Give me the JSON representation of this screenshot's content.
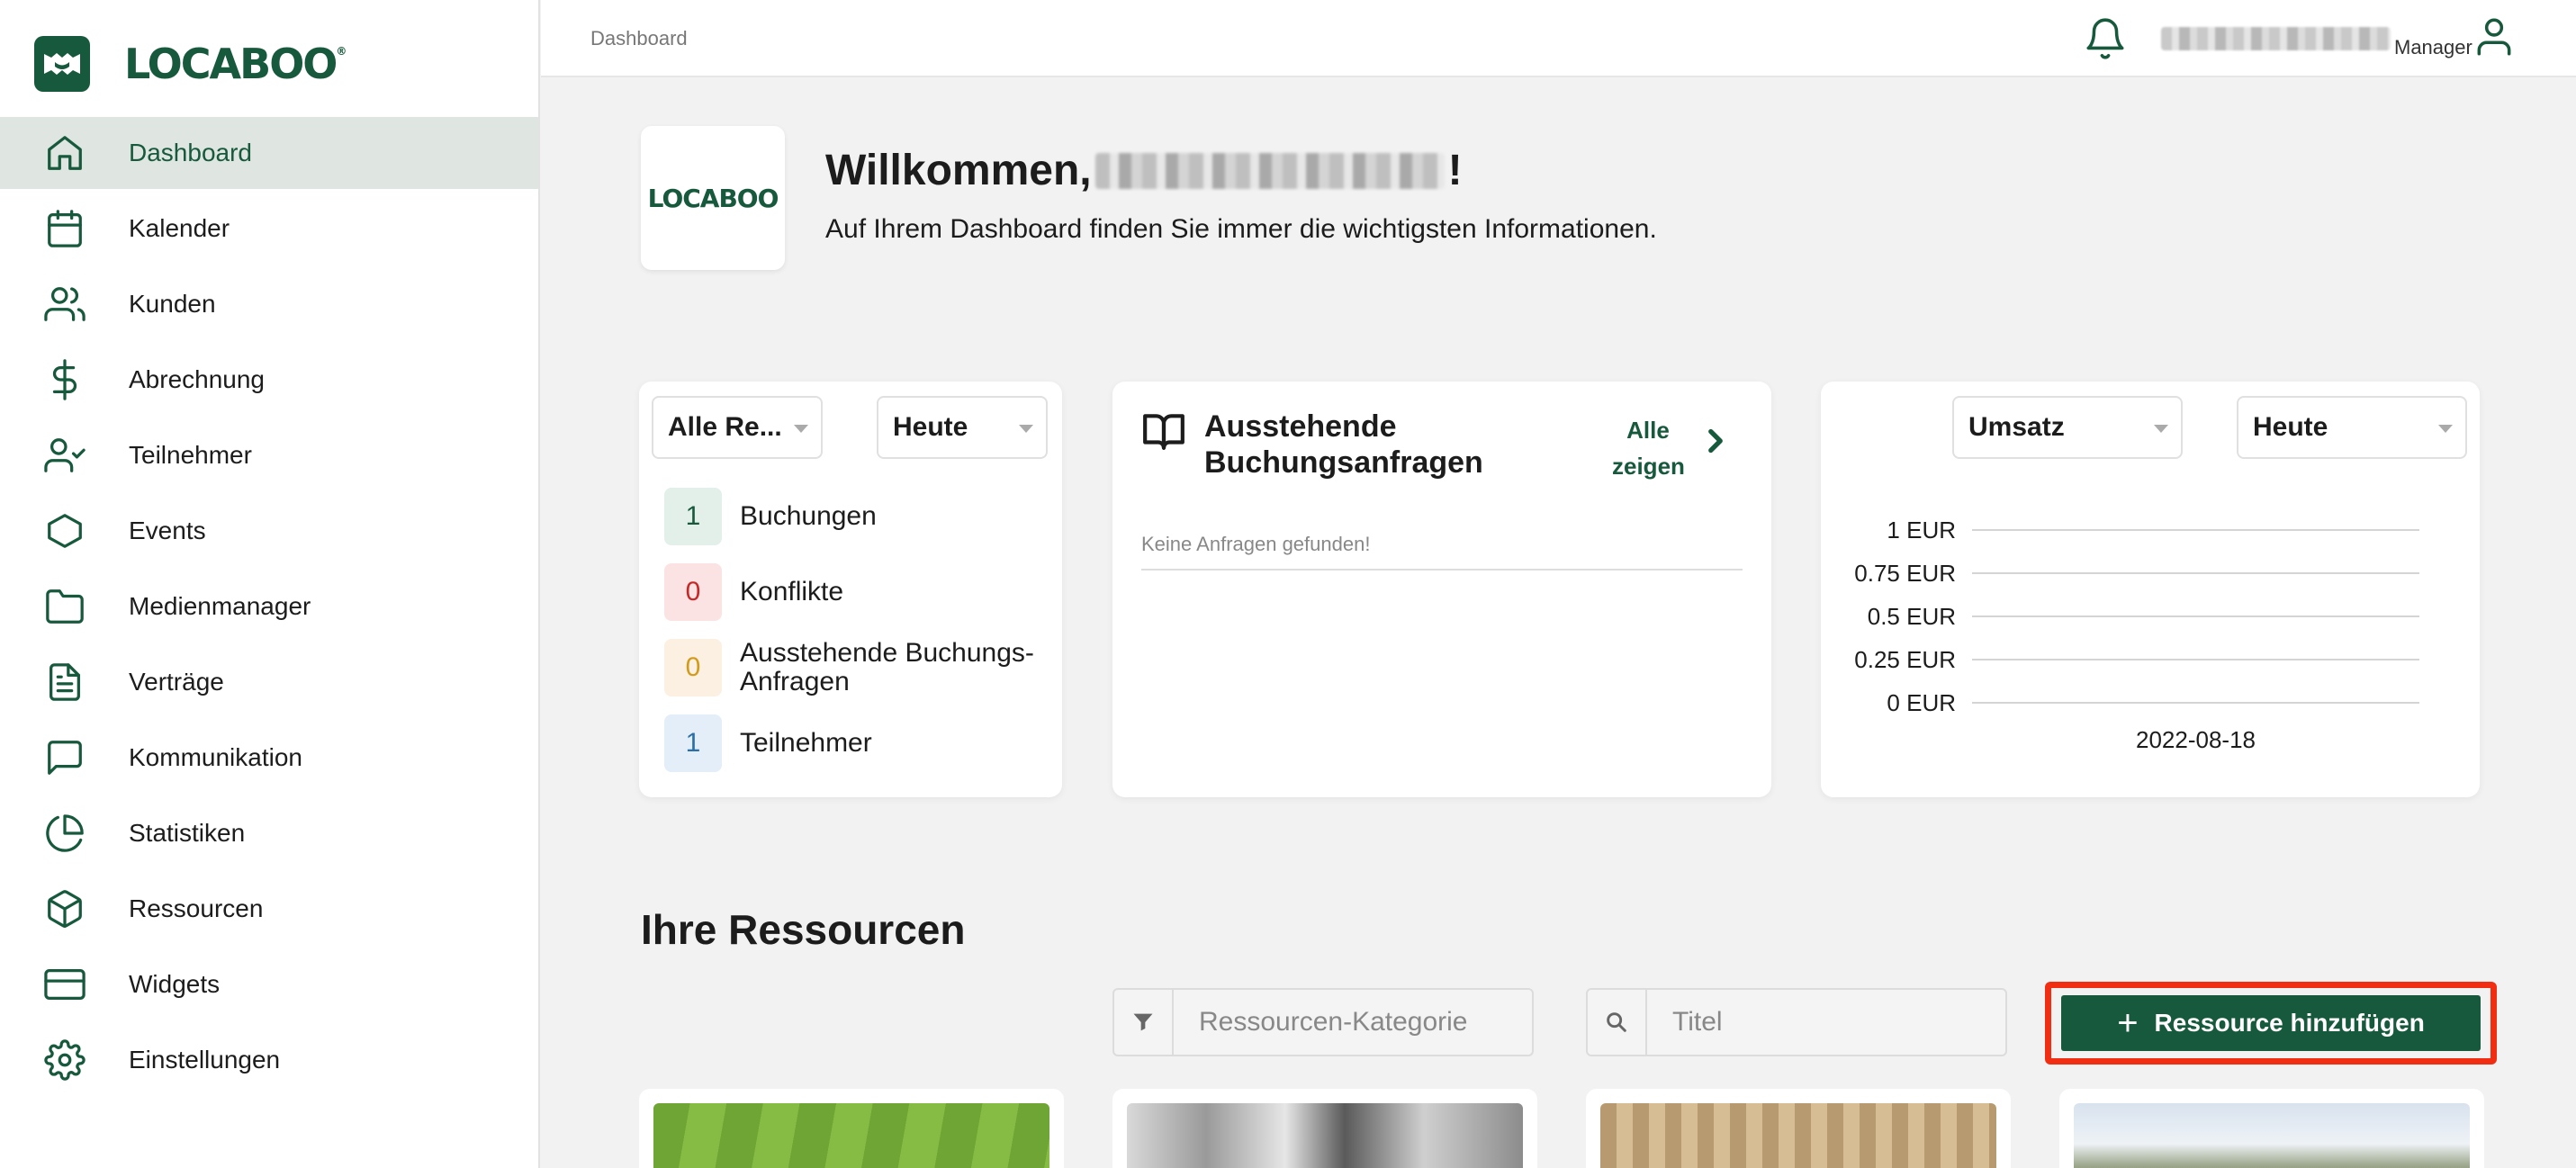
{
  "app": {
    "brand": "LOCABOO",
    "brand_registered": "®"
  },
  "sidebar": {
    "items": [
      {
        "label": "Dashboard",
        "icon": "home-icon",
        "active": true
      },
      {
        "label": "Kalender",
        "icon": "calendar-icon"
      },
      {
        "label": "Kunden",
        "icon": "users-icon"
      },
      {
        "label": "Abrechnung",
        "icon": "dollar-icon"
      },
      {
        "label": "Teilnehmer",
        "icon": "user-check-icon"
      },
      {
        "label": "Events",
        "icon": "hexagon-icon"
      },
      {
        "label": "Medienmanager",
        "icon": "folder-icon"
      },
      {
        "label": "Verträge",
        "icon": "file-text-icon"
      },
      {
        "label": "Kommunikation",
        "icon": "message-square-icon"
      },
      {
        "label": "Statistiken",
        "icon": "pie-chart-icon"
      },
      {
        "label": "Ressourcen",
        "icon": "box-icon"
      },
      {
        "label": "Widgets",
        "icon": "credit-card-icon"
      },
      {
        "label": "Einstellungen",
        "icon": "settings-icon"
      }
    ]
  },
  "header": {
    "breadcrumb": "Dashboard",
    "user_role": "Manager"
  },
  "welcome": {
    "logo_text": "LOCABOO",
    "title_prefix": "Willkommen,",
    "title_suffix": "!",
    "subtitle": "Auf Ihrem Dashboard finden Sie immer die wichtigsten Informationen."
  },
  "overview_card": {
    "resource_select": "Alle Re...",
    "period_select": "Heute",
    "stats": [
      {
        "value": "1",
        "label": "Buchungen",
        "color": "#17593c",
        "bg": "#e3efe9"
      },
      {
        "value": "0",
        "label": "Konflikte",
        "color": "#c62828",
        "bg": "#fbe3e4"
      },
      {
        "value": "0",
        "label": "Ausstehende Buchungs-\nAnfragen",
        "color": "#d39b1a",
        "bg": "#fcf0e2"
      },
      {
        "value": "1",
        "label": "Teilnehmer",
        "color": "#2a6fa5",
        "bg": "#e3eef8"
      }
    ]
  },
  "requests_card": {
    "title_line1": "Ausstehende",
    "title_line2": "Buchungsanfragen",
    "show_all_line1": "Alle",
    "show_all_line2": "zeigen",
    "empty_text": "Keine Anfragen gefunden!"
  },
  "revenue_card": {
    "metric_select": "Umsatz",
    "period_select": "Heute"
  },
  "chart_data": {
    "type": "line",
    "x": [
      "2022-08-18"
    ],
    "series": [
      {
        "values": [
          0
        ]
      }
    ],
    "yticks": [
      "1 EUR",
      "0.75 EUR",
      "0.5 EUR",
      "0.25 EUR",
      "0 EUR"
    ],
    "ylim": [
      0,
      1
    ],
    "grid": true
  },
  "resources": {
    "title": "Ihre Ressourcen",
    "category_placeholder": "Ressourcen-Kategorie",
    "title_placeholder": "Titel",
    "add_button": "Ressource hinzufügen",
    "add_button_highlight": "#f12e12",
    "primary_color": "#17593c"
  }
}
